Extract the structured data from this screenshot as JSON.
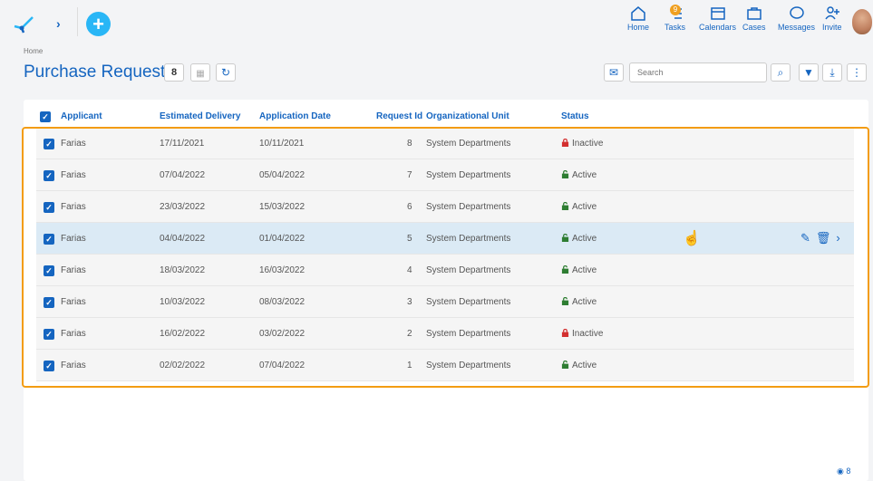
{
  "nav": [
    {
      "label": "Home",
      "icon": "home-icon"
    },
    {
      "label": "Tasks",
      "icon": "tasks-icon",
      "badge": "9"
    },
    {
      "label": "Calendars",
      "icon": "calendar-icon"
    },
    {
      "label": "Cases",
      "icon": "briefcase-icon"
    },
    {
      "label": "Messages",
      "icon": "message-icon"
    },
    {
      "label": "Invite",
      "icon": "invite-icon"
    }
  ],
  "breadcrumb": "Home",
  "title": "Purchase Request",
  "count": "8",
  "search_placeholder": "Search",
  "columns": [
    "Applicant",
    "Estimated Delivery",
    "Application Date",
    "Request Id",
    "Organizational Unit",
    "Status"
  ],
  "rows": [
    {
      "applicant": "Farias",
      "estimated": "17/11/2021",
      "application": "10/11/2021",
      "id": "8",
      "unit": "System Departments",
      "status": "Inactive"
    },
    {
      "applicant": "Farias",
      "estimated": "07/04/2022",
      "application": "05/04/2022",
      "id": "7",
      "unit": "System Departments",
      "status": "Active"
    },
    {
      "applicant": "Farias",
      "estimated": "23/03/2022",
      "application": "15/03/2022",
      "id": "6",
      "unit": "System Departments",
      "status": "Active"
    },
    {
      "applicant": "Farias",
      "estimated": "04/04/2022",
      "application": "01/04/2022",
      "id": "5",
      "unit": "System Departments",
      "status": "Active"
    },
    {
      "applicant": "Farias",
      "estimated": "18/03/2022",
      "application": "16/03/2022",
      "id": "4",
      "unit": "System Departments",
      "status": "Active"
    },
    {
      "applicant": "Farias",
      "estimated": "10/03/2022",
      "application": "08/03/2022",
      "id": "3",
      "unit": "System Departments",
      "status": "Active"
    },
    {
      "applicant": "Farias",
      "estimated": "16/02/2022",
      "application": "03/02/2022",
      "id": "2",
      "unit": "System Departments",
      "status": "Inactive"
    },
    {
      "applicant": "Farias",
      "estimated": "02/02/2022",
      "application": "07/04/2022",
      "id": "1",
      "unit": "System Departments",
      "status": "Active"
    }
  ],
  "footer_count": "8",
  "colors": {
    "accent": "#1565c0",
    "highlight": "#f39c12",
    "active": "#2e7d32",
    "inactive": "#d32f2f"
  }
}
